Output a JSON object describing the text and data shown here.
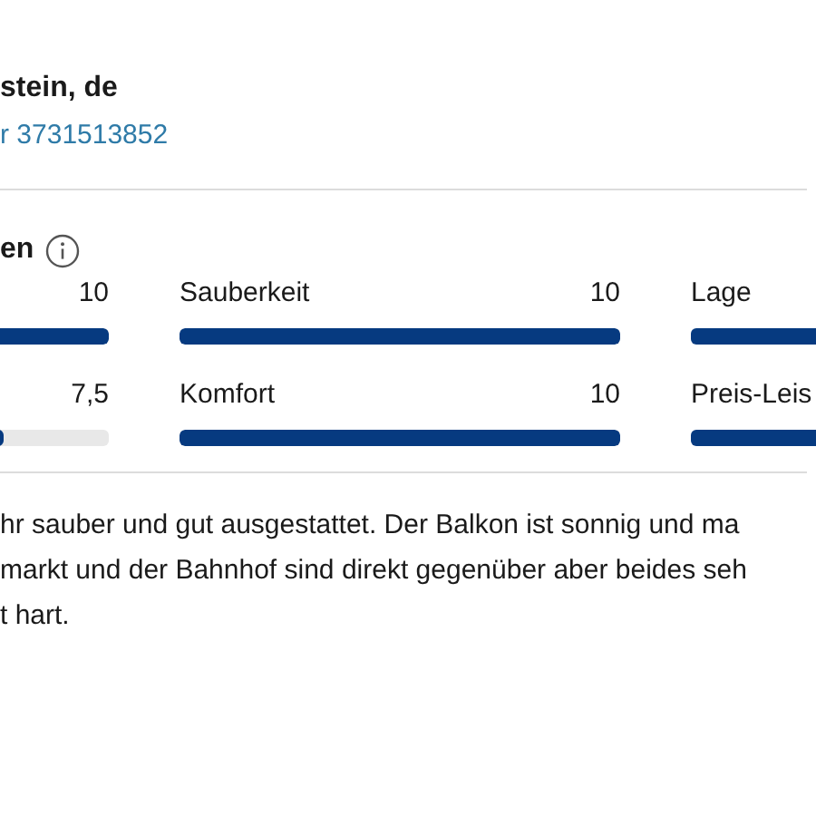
{
  "header": {
    "title": "stein, de",
    "link": "r 3731513852"
  },
  "ratings": {
    "heading": "en",
    "rows": [
      [
        {
          "value": "10",
          "level": 1
        },
        {
          "label": "Sauberkeit",
          "value": "10",
          "level": 1
        },
        {
          "label": "Lage"
        }
      ],
      [
        {
          "value": "7,5",
          "level": 0.75
        },
        {
          "label": "Komfort",
          "value": "10",
          "level": 1
        },
        {
          "label": "Preis-Leis"
        }
      ]
    ]
  },
  "review": {
    "lines": [
      "hr sauber und gut ausgestattet. Der Balkon ist sonnig und ma",
      "markt und der Bahnhof sind direkt gegenüber aber beides seh",
      "t hart."
    ]
  }
}
